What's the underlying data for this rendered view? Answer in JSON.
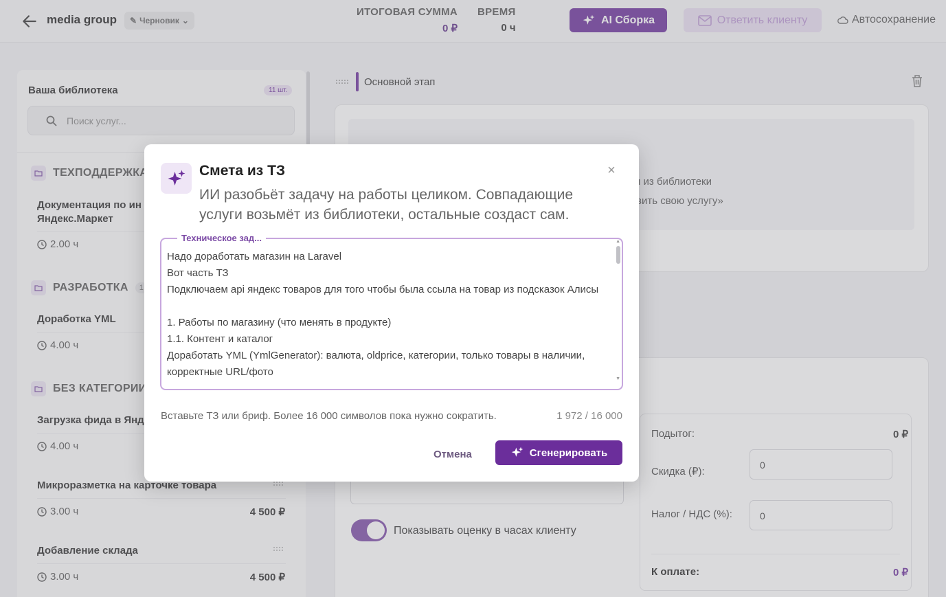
{
  "header": {
    "project_name": "media group",
    "status": "Черновик",
    "total_label": "ИТОГОВАЯ СУММА",
    "total_value": "0 ₽",
    "time_label": "ВРЕМЯ",
    "time_value": "0 ч",
    "ai_button": "AI Сборка",
    "reply_button": "Ответить клиенту",
    "autosave": "Автосохранение"
  },
  "library": {
    "title": "Ваша библиотека",
    "count": "11 шт.",
    "search_placeholder": "Поиск услуг...",
    "categories": [
      {
        "name": "ТЕХПОДДЕРЖКА",
        "count": ""
      },
      {
        "name": "РАЗРАБОТКА",
        "count": "1"
      },
      {
        "name": "БЕЗ КАТЕГОРИИ",
        "count": ""
      }
    ],
    "services": [
      {
        "name": "Документация по ин\nЯндекс.Маркет",
        "hours": "2.00 ч",
        "price": ""
      },
      {
        "name": "Доработка YML",
        "hours": "4.00 ч",
        "price": ""
      },
      {
        "name": "Загрузка фида в Янд",
        "hours": "4.00 ч",
        "price": ""
      },
      {
        "name": "Микроразметка на карточке товара",
        "hours": "3.00 ч",
        "price": "4 500 ₽"
      },
      {
        "name": "Добавление склада",
        "hours": "3.00 ч",
        "price": "4 500 ₽"
      }
    ]
  },
  "stage": {
    "title": "Основной этап",
    "empty_line1": "и из библиотеки",
    "empty_line2": "вить свою услугу»"
  },
  "totals": {
    "subtotal_label": "Подытог:",
    "subtotal_value": "0 ₽",
    "discount_label": "Скидка (₽):",
    "discount_value": "0",
    "tax_label": "Налог / НДС (%):",
    "tax_value": "0",
    "pay_label": "К оплате:",
    "pay_value": "0 ₽",
    "show_hours_label": "Показывать оценку в часах клиенту"
  },
  "modal": {
    "title": "Смета из ТЗ",
    "subtitle": "ИИ разобьёт задачу на работы целиком. Совпадающие услуги возьмёт из библиотеки, остальные создаст сам.",
    "field_label": "Техническое зад...",
    "text": "Надо доработать магазин на Laravel\nВот часть ТЗ\nПодключаем api яндекс товаров для того чтобы была ссыла на товар из подсказок Алисы\n\n1. Работы по магазину (что менять в продукте)\n1.1. Контент и каталог\nДоработать YML (YmlGenerator): валюта, oldprice, категории, только товары в наличии, корректные URL/фото",
    "hint": "Вставьте ТЗ или бриф. Более 16 000 символов пока нужно сократить.",
    "counter": "1 972 / 16 000",
    "cancel": "Отмена",
    "generate": "Сгенерировать"
  }
}
